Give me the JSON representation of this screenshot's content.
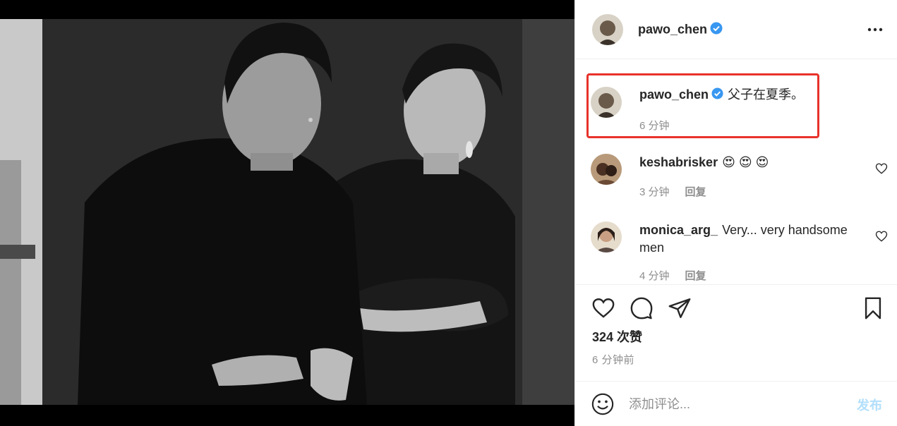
{
  "post": {
    "username": "pawo_chen",
    "caption": "父子在夏季。",
    "caption_time": "6 分钟",
    "likes": "324 次赞",
    "time_ago": "6 分钟前"
  },
  "comments": [
    {
      "username": "keshabrisker",
      "text": "😍 😍 😍",
      "time": "3 分钟",
      "reply": "回复"
    },
    {
      "username": "monica_arg_",
      "text": "Very... very handsome men",
      "time": "4 分钟",
      "reply": "回复"
    }
  ],
  "comment_box": {
    "placeholder": "添加评论...",
    "post_label": "发布"
  },
  "icons": {
    "verified": "verified-badge-icon",
    "more": "more-options-icon",
    "heart": "heart-icon",
    "comment": "comment-icon",
    "share": "share-icon",
    "save": "bookmark-icon",
    "emoji": "emoji-icon"
  },
  "colors": {
    "verified": "#3897f0",
    "highlight": "#e8322b",
    "secondary_text": "#8e8e8e",
    "post_button_disabled": "#b2dffc"
  }
}
